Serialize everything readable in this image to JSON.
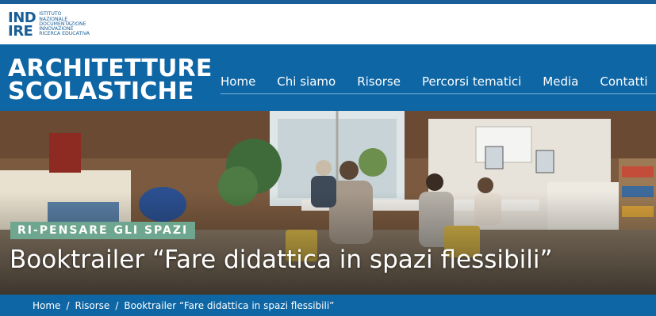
{
  "logo": {
    "mark_line1": "IND",
    "mark_line2": "IRE",
    "text_lines": [
      "ISTITUTO",
      "NAZIONALE",
      "DOCUMENTAZIONE",
      "INNOVAZIONE",
      "RICERCA EDUCATIVA"
    ]
  },
  "header": {
    "brand_line1": "ARCHITETTURE",
    "brand_line2": "SCOLASTICHE",
    "nav": [
      "Home",
      "Chi siamo",
      "Risorse",
      "Percorsi tematici",
      "Media",
      "Contatti"
    ]
  },
  "hero": {
    "tag": "RI-PENSARE GLI SPAZI",
    "title": "Booktrailer “Fare didattica in spazi flessibili”"
  },
  "breadcrumb": {
    "items": [
      "Home",
      "Risorse",
      "Booktrailer “Fare didattica in spazi flessibili”"
    ],
    "separator": "/"
  },
  "colors": {
    "brand_blue": "#0e66a5",
    "tag_green": "#6fa68f"
  }
}
